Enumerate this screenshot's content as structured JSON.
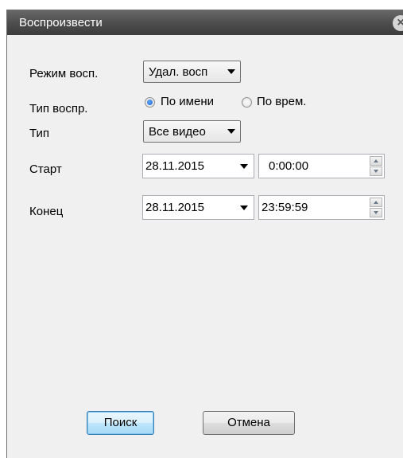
{
  "window": {
    "title": "Воспроизвести",
    "close_symbol": "×"
  },
  "form": {
    "mode": {
      "label": "Режим восп.",
      "value": "Удал. восп"
    },
    "play_type": {
      "label": "Тип воспр.",
      "options": [
        {
          "label": "По имени",
          "checked": true
        },
        {
          "label": "По врем.",
          "checked": false
        }
      ]
    },
    "type": {
      "label": "Тип",
      "value": "Все видео"
    },
    "start": {
      "label": "Старт",
      "date": "28.11.2015",
      "time": "0:00:00"
    },
    "end": {
      "label": "Конец",
      "date": "28.11.2015",
      "time": "23:59:59"
    }
  },
  "buttons": {
    "search": "Поиск",
    "cancel": "Отмена"
  },
  "colors": {
    "titlebar": "#4f4f4f",
    "dialog_bg": "#f0f0f0",
    "accent": "#1a5fc2"
  }
}
